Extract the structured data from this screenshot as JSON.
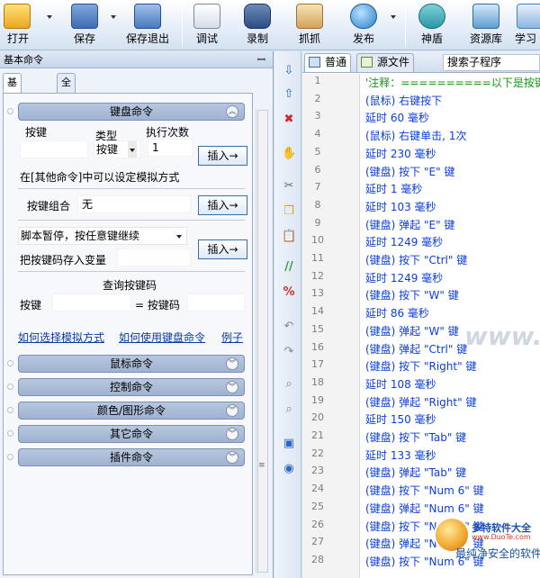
{
  "toolbar": {
    "buttons": [
      {
        "label": "打开"
      },
      {
        "label": "保存"
      },
      {
        "label": "保存退出"
      },
      {
        "label": "调试"
      },
      {
        "label": "录制"
      },
      {
        "label": "抓抓"
      },
      {
        "label": "发布"
      },
      {
        "label": "神盾"
      },
      {
        "label": "资源库"
      },
      {
        "label": "学习"
      }
    ]
  },
  "left_panel": {
    "title": "基本命令",
    "pin": "ꟷ",
    "tabs": [
      {
        "label": "基本命令"
      },
      {
        "label": "全部命令"
      }
    ],
    "keyboard": {
      "header": "键盘命令",
      "col_key": "按键",
      "col_type": "类型",
      "col_count": "执行次数",
      "type_value": "按键",
      "count_value": "1",
      "insert": "插入→",
      "hint": "在[其他命令]中可以设定模拟方式",
      "combo_label": "按键组合",
      "combo_value": "无",
      "insert2": "插入→",
      "pause_option": "脚本暂停，按任意键继续",
      "store_label": "把按键码存入变量",
      "insert3": "插入→",
      "query_title": "查询按键码",
      "query_key": "按键",
      "query_code": "= 按键码",
      "link1": "如何选择模拟方式",
      "link2": "如何使用键盘命令",
      "link3": "例子"
    },
    "sections": [
      {
        "label": "鼠标命令"
      },
      {
        "label": "控制命令"
      },
      {
        "label": "颜色/图形命令"
      },
      {
        "label": "其它命令"
      },
      {
        "label": "插件命令"
      }
    ]
  },
  "editor": {
    "tabs": [
      {
        "label": "普通"
      },
      {
        "label": "源文件"
      }
    ],
    "search_label": "搜索子程序",
    "lines": [
      {
        "n": "1",
        "text": "'注释：==========以下是按键精",
        "type": "comment"
      },
      {
        "n": "2",
        "text": "(鼠标) 右键按下",
        "type": "code"
      },
      {
        "n": "3",
        "text": "延时 60 毫秒",
        "type": "code"
      },
      {
        "n": "4",
        "text": "(鼠标) 右键单击, 1次",
        "type": "code"
      },
      {
        "n": "5",
        "text": "延时 230 毫秒",
        "type": "code"
      },
      {
        "n": "6",
        "text": "(键盘) 按下 \"E\" 键",
        "type": "code"
      },
      {
        "n": "7",
        "text": "延时 1 毫秒",
        "type": "code"
      },
      {
        "n": "8",
        "text": "延时 103 毫秒",
        "type": "code"
      },
      {
        "n": "9",
        "text": "(键盘) 弹起 \"E\" 键",
        "type": "code"
      },
      {
        "n": "10",
        "text": "延时 1249 毫秒",
        "type": "code"
      },
      {
        "n": "11",
        "text": "(键盘) 按下 \"Ctrl\" 键",
        "type": "code"
      },
      {
        "n": "12",
        "text": "延时 1249 毫秒",
        "type": "code"
      },
      {
        "n": "13",
        "text": "(键盘) 按下 \"W\" 键",
        "type": "code"
      },
      {
        "n": "14",
        "text": "延时 86 毫秒",
        "type": "code"
      },
      {
        "n": "15",
        "text": "(键盘) 弹起 \"W\" 键",
        "type": "code"
      },
      {
        "n": "16",
        "text": "(键盘) 弹起 \"Ctrl\" 键",
        "type": "code"
      },
      {
        "n": "17",
        "text": "(键盘) 按下 \"Right\" 键",
        "type": "code"
      },
      {
        "n": "18",
        "text": "延时 108 毫秒",
        "type": "code"
      },
      {
        "n": "19",
        "text": "(键盘) 弹起 \"Right\" 键",
        "type": "code"
      },
      {
        "n": "20",
        "text": "延时 150 毫秒",
        "type": "code"
      },
      {
        "n": "21",
        "text": "(键盘) 按下 \"Tab\" 键",
        "type": "code"
      },
      {
        "n": "22",
        "text": "延时 133 毫秒",
        "type": "code"
      },
      {
        "n": "23",
        "text": "(键盘) 弹起 \"Tab\" 键",
        "type": "code"
      },
      {
        "n": "24",
        "text": "(键盘) 按下 \"Num 6\" 键",
        "type": "code"
      },
      {
        "n": "25",
        "text": "(键盘) 弹起 \"Num 6\" 键",
        "type": "code"
      },
      {
        "n": "26",
        "text": "(键盘) 按下 \"Num 0\" 键",
        "type": "code"
      },
      {
        "n": "27",
        "text": "(键盘) 弹起 \"Num 0\" 键",
        "type": "code"
      },
      {
        "n": "28",
        "text": "(键盘) 按下 \"Num 6\" 键",
        "type": "code"
      }
    ]
  },
  "watermark": "www.DuoTe.com",
  "brand": {
    "title": "多特软件大全",
    "url": "www.DuoTe.com",
    "sub": "最纯净安全的软件站"
  },
  "colors": {
    "code": "#0a3ee0",
    "comment": "#179817",
    "link": "#0b3aa8"
  }
}
